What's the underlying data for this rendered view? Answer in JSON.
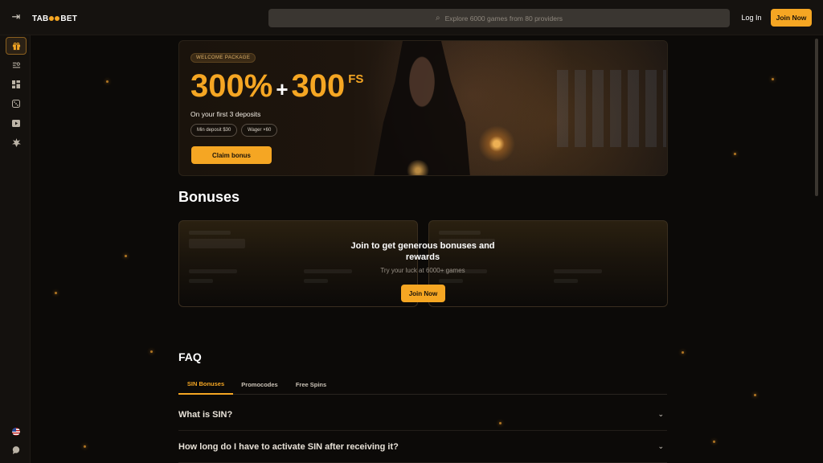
{
  "header": {
    "collapse_icon": "sidebar-collapse-icon",
    "logo": {
      "part1": "TAB",
      "part2": "BET"
    },
    "search": {
      "placeholder": "Explore 6000 games from 80 providers",
      "icon": "search-icon"
    },
    "login_label": "Log In",
    "join_label": "Join Now"
  },
  "sidebar": {
    "items": [
      {
        "name": "gift-icon",
        "active": true
      },
      {
        "name": "list-search-icon",
        "active": false
      },
      {
        "name": "grid-icon",
        "active": false
      },
      {
        "name": "dice-icon",
        "active": false
      },
      {
        "name": "play-icon",
        "active": false
      },
      {
        "name": "star-burst-icon",
        "active": false
      }
    ],
    "bottom": [
      {
        "name": "us-flag-icon"
      },
      {
        "name": "chat-icon"
      }
    ]
  },
  "hero": {
    "badge": "WELCOME PACKAGE",
    "percent": "300%",
    "plus": "+",
    "spins": "300",
    "spins_unit": "FS",
    "subtitle": "On your first 3 deposits",
    "chips": [
      "Min deposit $30",
      "Wager ×60"
    ],
    "cta": "Claim bonus"
  },
  "bonuses": {
    "title": "Bonuses",
    "overlay_title": "Join to get generous bonuses and rewards",
    "overlay_sub": "Try your luck at 6000+ games",
    "cta": "Join Now"
  },
  "faq": {
    "title": "FAQ",
    "tabs": [
      {
        "label": "SIN Bonuses",
        "active": true
      },
      {
        "label": "Promocodes",
        "active": false
      },
      {
        "label": "Free Spins",
        "active": false
      }
    ],
    "questions": [
      "What is SIN?",
      "How long do I have to activate SIN after receiving it?"
    ]
  },
  "colors": {
    "accent": "#f5a623",
    "background": "#0c0a08",
    "panel": "#15120f"
  }
}
